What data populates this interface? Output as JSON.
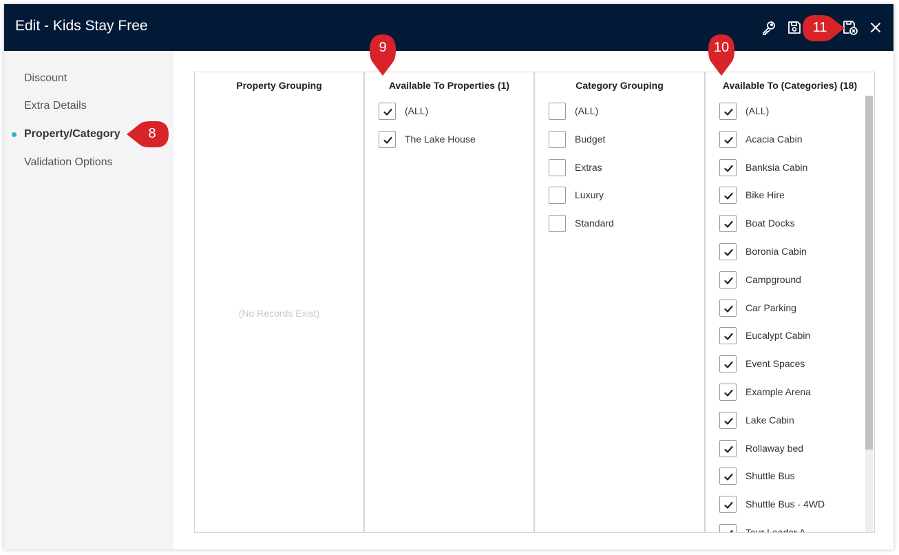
{
  "window": {
    "title": "Edit - Kids Stay Free",
    "header_icons": [
      "key-icon",
      "save-icon",
      "save-close-icon",
      "close-icon"
    ]
  },
  "sidebar": {
    "items": [
      {
        "label": "Discount",
        "active": false
      },
      {
        "label": "Extra Details",
        "active": false
      },
      {
        "label": "Property/Category",
        "active": true
      },
      {
        "label": "Validation Options",
        "active": false
      }
    ]
  },
  "panels": {
    "property_grouping": {
      "title": "Property Grouping",
      "empty_message": "(No Records Exist)"
    },
    "available_properties": {
      "title": "Available To Properties (1)",
      "items": [
        {
          "label": "(ALL)",
          "checked": true
        },
        {
          "label": "The Lake House",
          "checked": true
        }
      ]
    },
    "category_grouping": {
      "title": "Category Grouping",
      "items": [
        {
          "label": "(ALL)",
          "checked": false
        },
        {
          "label": "Budget",
          "checked": false
        },
        {
          "label": "Extras",
          "checked": false
        },
        {
          "label": "Luxury",
          "checked": false
        },
        {
          "label": "Standard",
          "checked": false
        }
      ]
    },
    "available_categories": {
      "title": "Available To (Categories) (18)",
      "items": [
        {
          "label": "(ALL)",
          "checked": true
        },
        {
          "label": "Acacia Cabin",
          "checked": true
        },
        {
          "label": "Banksia Cabin",
          "checked": true
        },
        {
          "label": "Bike Hire",
          "checked": true
        },
        {
          "label": "Boat Docks",
          "checked": true
        },
        {
          "label": "Boronia Cabin",
          "checked": true
        },
        {
          "label": "Campground",
          "checked": true
        },
        {
          "label": "Car Parking",
          "checked": true
        },
        {
          "label": "Eucalypt Cabin",
          "checked": true
        },
        {
          "label": "Event Spaces",
          "checked": true
        },
        {
          "label": "Example Arena",
          "checked": true
        },
        {
          "label": "Lake Cabin",
          "checked": true
        },
        {
          "label": "Rollaway bed",
          "checked": true
        },
        {
          "label": "Shuttle Bus",
          "checked": true
        },
        {
          "label": "Shuttle Bus - 4WD",
          "checked": true
        },
        {
          "label": "Tour Leader A",
          "checked": true
        }
      ]
    }
  },
  "callouts": [
    "8",
    "9",
    "10",
    "11"
  ],
  "colors": {
    "header_bg": "#031a36",
    "sidebar_bg": "#f4f4f4",
    "active_dot": "#29b6c6",
    "callout": "#d8232a"
  }
}
